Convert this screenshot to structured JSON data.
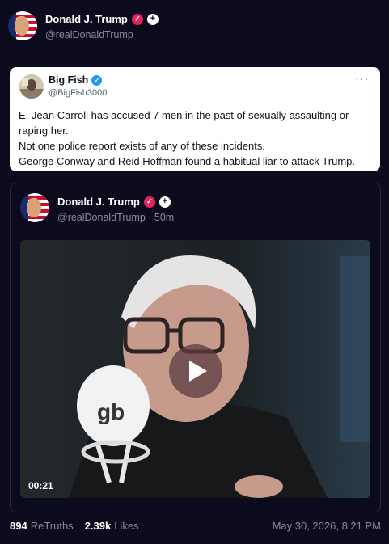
{
  "post": {
    "display_name": "Donald J. Trump",
    "handle": "@realDonaldTrump",
    "verified_icon": "check-badge-icon",
    "plus_icon": "plus-badge-icon"
  },
  "quote": {
    "display_name": "Big Fish",
    "handle": "@BigFish3000",
    "more_label": "···",
    "lines": [
      "E. Jean Carroll has accused 7 men in the past of sexually assaulting or",
      "raping her.",
      "Not one police report exists of any of these incidents.",
      "George Conway and Reid Hoffman found a habitual liar to attack Trump."
    ]
  },
  "retruth": {
    "display_name": "Donald J. Trump",
    "handle_time": "@realDonaldTrump · 50m",
    "video_duration": "00:21"
  },
  "stats": {
    "retruths_count": "894",
    "retruths_label": "ReTruths",
    "likes_count": "2.39k",
    "likes_label": "Likes",
    "timestamp": "May 30, 2026, 8:21 PM"
  },
  "colors": {
    "background": "#0c0a1d",
    "verified_badge": "#e0245e",
    "blue_badge": "#1d9bf0"
  }
}
